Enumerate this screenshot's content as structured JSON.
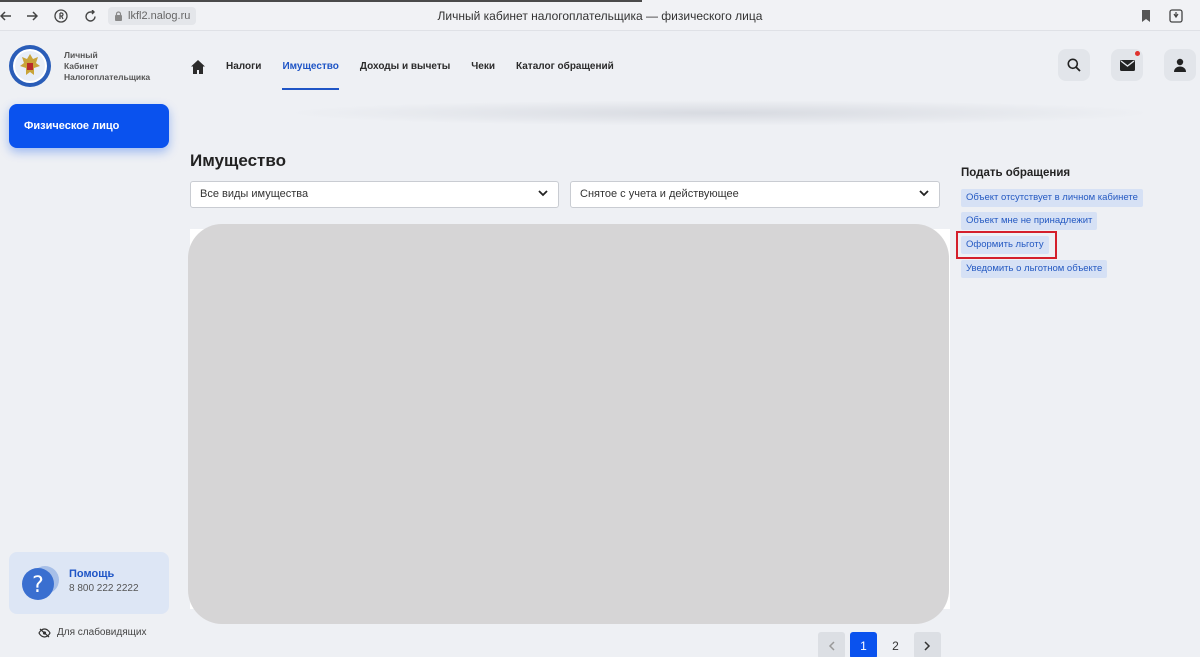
{
  "browser": {
    "url": "lkfl2.nalog.ru",
    "window_title": "Личный кабинет налогоплательщика — физического лица"
  },
  "brand": {
    "line1": "Личный",
    "line2": "Кабинет",
    "line3": "Налогоплательщика"
  },
  "sidebar": {
    "person_label": "Физическое лицо",
    "help_title": "Помощь",
    "help_phone": "8 800 222 2222",
    "accessibility_label": "Для слабовидящих"
  },
  "nav": {
    "items": [
      {
        "label": "Налоги",
        "active": false
      },
      {
        "label": "Имущество",
        "active": true
      },
      {
        "label": "Доходы и вычеты",
        "active": false
      },
      {
        "label": "Чеки",
        "active": false
      },
      {
        "label": "Каталог обращений",
        "active": false
      }
    ]
  },
  "main": {
    "title": "Имущество",
    "filter_type": "Все виды имущества",
    "filter_status": "Снятое с учета и действующее"
  },
  "pagination": {
    "pages": [
      "1",
      "2"
    ],
    "current": "1"
  },
  "requests": {
    "title": "Подать обращения",
    "links": [
      "Объект отсутствует в личном кабинете",
      "Объект мне не принадлежит",
      "Оформить льготу",
      "Уведомить о льготном объекте"
    ]
  },
  "colors": {
    "accent": "#0a52ee",
    "link": "#1f55c6",
    "highlight": "#d41f2b"
  }
}
